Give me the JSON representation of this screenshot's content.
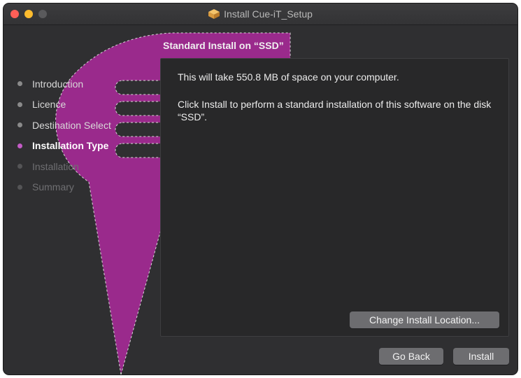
{
  "window": {
    "title": "Install Cue-iT_Setup",
    "traffic_lights": {
      "close": "#fe5f57",
      "minimize": "#febc2e",
      "zoom": "#5a5a5c"
    }
  },
  "brand": {
    "accent": "#9a2a8c",
    "step_current": "#c45bc6"
  },
  "sidebar": {
    "steps": [
      {
        "label": "Introduction",
        "state": "done"
      },
      {
        "label": "Licence",
        "state": "done"
      },
      {
        "label": "Destination Select",
        "state": "done"
      },
      {
        "label": "Installation Type",
        "state": "current"
      },
      {
        "label": "Installation",
        "state": "pending"
      },
      {
        "label": "Summary",
        "state": "pending"
      }
    ]
  },
  "main": {
    "heading": "Standard Install on “SSD”",
    "space_text": "This will take 550.8 MB of space on your computer.",
    "instructions": "Click Install to perform a standard installation of this software on the disk “SSD”.",
    "change_location_label": "Change Install Location..."
  },
  "footer": {
    "back_label": "Go Back",
    "install_label": "Install"
  },
  "icons": {
    "title_icon": "package-icon"
  }
}
